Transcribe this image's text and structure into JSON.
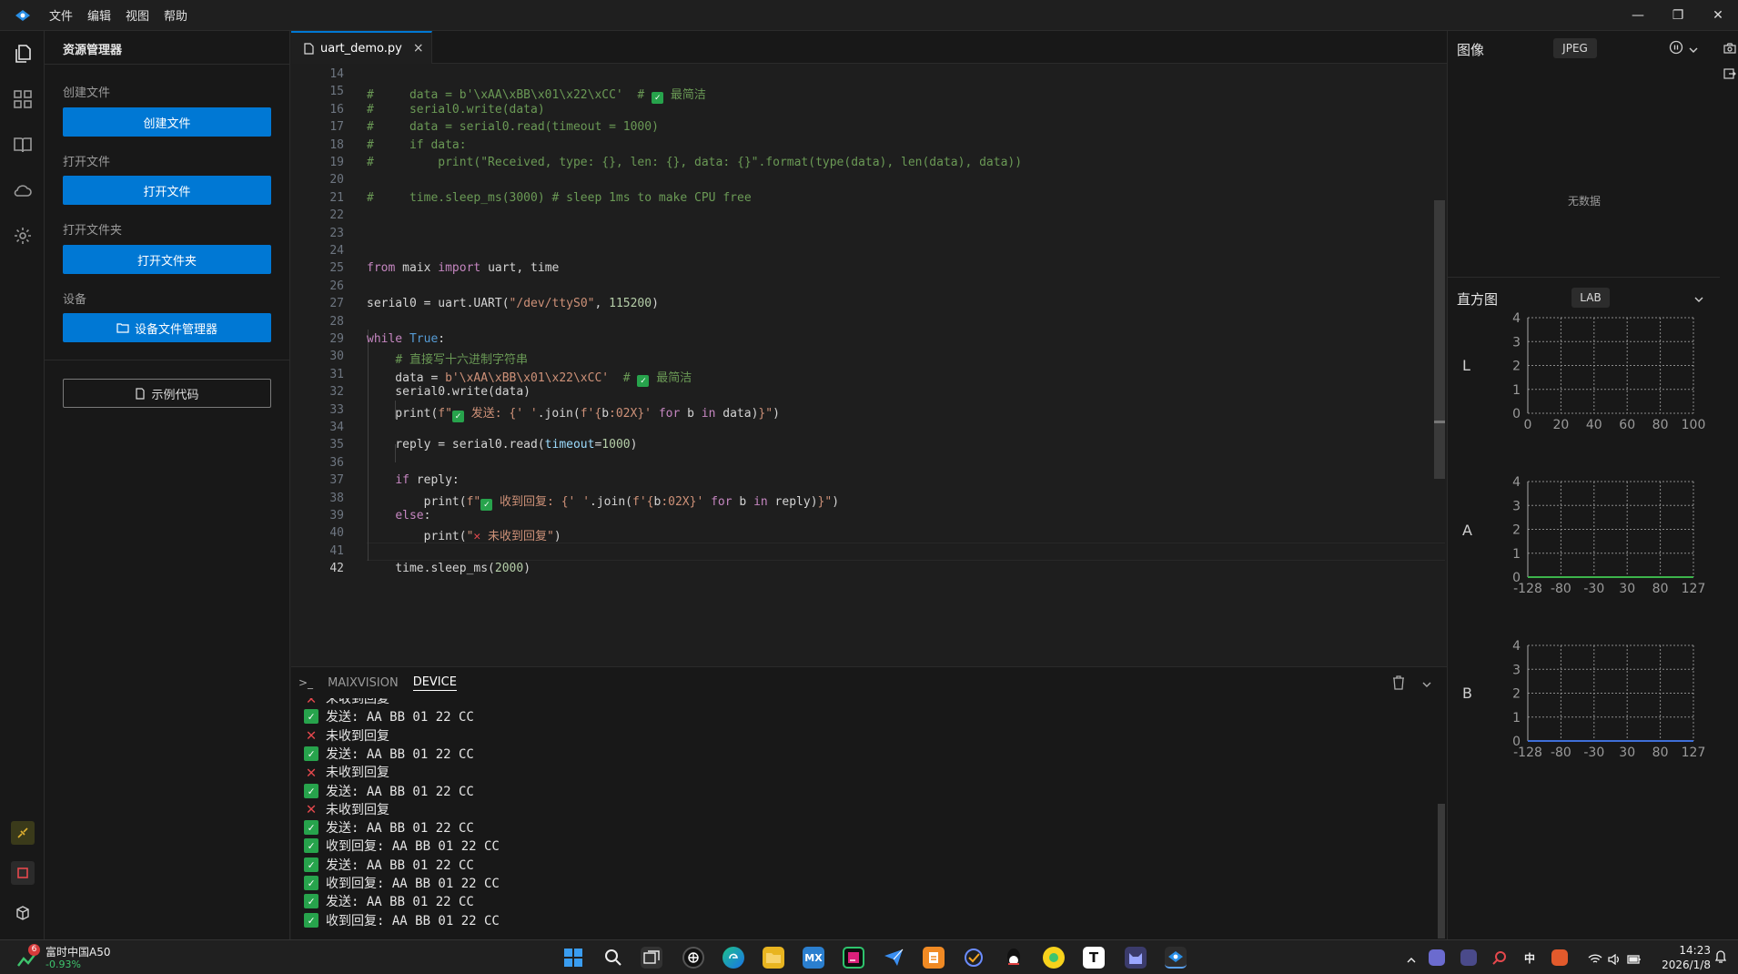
{
  "titlebar": {
    "menus": [
      "文件",
      "编辑",
      "视图",
      "帮助"
    ],
    "minimize": "—",
    "restore": "❐",
    "close": "✕"
  },
  "sidebar": {
    "title": "资源管理器",
    "create_label": "创建文件",
    "create_button": "创建文件",
    "open_label": "打开文件",
    "open_button": "打开文件",
    "open_folder_label": "打开文件夹",
    "open_folder_button": "打开文件夹",
    "device_label": "设备",
    "device_button": "设备文件管理器",
    "example_button": "示例代码"
  },
  "editor": {
    "tab": "uart_demo.py",
    "tab_close": "×",
    "active_line": 42
  },
  "code_lines": [
    {
      "n": "14",
      "html": ""
    },
    {
      "n": "15",
      "html": "<span class='cm'>#     data = b'\\xAA\\xBB\\x01\\x22\\xCC'  # </span><span class='chk'>✓</span><span class='cm'> 最简洁</span>"
    },
    {
      "n": "16",
      "html": "<span class='cm'>#     serial0.write(data)</span>"
    },
    {
      "n": "17",
      "html": "<span class='cm'>#     data = serial0.read(timeout = 1000)</span>"
    },
    {
      "n": "18",
      "html": "<span class='cm'>#     if data:</span>"
    },
    {
      "n": "19",
      "html": "<span class='cm'>#         print(\"Received, type: {}, len: {}, data: {}\".format(type(data), len(data), data))</span>"
    },
    {
      "n": "20",
      "html": ""
    },
    {
      "n": "21",
      "html": "<span class='cm'>#     time.sleep_ms(3000) # sleep 1ms to make CPU free</span>"
    },
    {
      "n": "22",
      "html": ""
    },
    {
      "n": "23",
      "html": ""
    },
    {
      "n": "24",
      "html": ""
    },
    {
      "n": "25",
      "html": "<span class='kw'>from</span> maix <span class='kw'>import</span> uart, time"
    },
    {
      "n": "26",
      "html": ""
    },
    {
      "n": "27",
      "html": "serial0 = uart.UART(<span class='st'>\"/dev/ttyS0\"</span>, <span class='nm'>115200</span>)"
    },
    {
      "n": "28",
      "html": ""
    },
    {
      "n": "29",
      "html": "<span class='kw'>while</span> <span class='kc'>True</span>:"
    },
    {
      "n": "30",
      "html": "    <span class='cm'># 直接写十六进制字符串</span>"
    },
    {
      "n": "31",
      "html": "    data = <span class='st'>b'\\xAA\\xBB\\x01\\x22\\xCC'</span>  <span class='cm'># </span><span class='chk'>✓</span><span class='cm'> 最简洁</span>"
    },
    {
      "n": "32",
      "html": "    serial0.write(data)"
    },
    {
      "n": "33",
      "html": "    print(<span class='st'>f\"</span><span class='chk'>✓</span><span class='st'> 发送: {</span><span class='st'>' '</span>.join(<span class='st'>f'{</span>b<span class='st'>:02X}'</span> <span class='kw'>for</span> b <span class='kw'>in</span> data)<span class='st'>}\"</span>)"
    },
    {
      "n": "34",
      "html": ""
    },
    {
      "n": "35",
      "html": "    reply = serial0.read(<span class='vr'>timeout</span>=<span class='nm'>1000</span>)"
    },
    {
      "n": "36",
      "html": ""
    },
    {
      "n": "37",
      "html": "    <span class='kw'>if</span> reply:"
    },
    {
      "n": "38",
      "html": "        print(<span class='st'>f\"</span><span class='chk'>✓</span><span class='st'> 收到回复: {</span><span class='st'>' '</span>.join(<span class='st'>f'{</span>b<span class='st'>:02X}'</span> <span class='kw'>for</span> b <span class='kw'>in</span> reply)<span class='st'>}\"</span>)"
    },
    {
      "n": "39",
      "html": "    <span class='kw'>else</span>:"
    },
    {
      "n": "40",
      "html": "        print(<span class='st'>\"</span><span class='xmk'>✕</span><span class='st'> 未收到回复\"</span>)"
    },
    {
      "n": "41",
      "html": ""
    },
    {
      "n": "42",
      "html": "    time.sleep_ms(<span class='nm'>2000</span>)"
    }
  ],
  "panel": {
    "prompt": ">_",
    "tabs": [
      "MAIXVISION",
      "DEVICE"
    ],
    "active_tab": "DEVICE",
    "lines": [
      {
        "ok": false,
        "text": "未收到回复"
      },
      {
        "ok": true,
        "text": "发送: AA BB 01 22 CC"
      },
      {
        "ok": false,
        "text": "未收到回复"
      },
      {
        "ok": true,
        "text": "发送: AA BB 01 22 CC"
      },
      {
        "ok": false,
        "text": "未收到回复"
      },
      {
        "ok": true,
        "text": "发送: AA BB 01 22 CC"
      },
      {
        "ok": false,
        "text": "未收到回复"
      },
      {
        "ok": true,
        "text": "发送: AA BB 01 22 CC"
      },
      {
        "ok": true,
        "text": "收到回复: AA BB 01 22 CC"
      },
      {
        "ok": true,
        "text": "发送: AA BB 01 22 CC"
      },
      {
        "ok": true,
        "text": "收到回复: AA BB 01 22 CC"
      },
      {
        "ok": true,
        "text": "发送: AA BB 01 22 CC"
      },
      {
        "ok": true,
        "text": "收到回复: AA BB 01 22 CC"
      }
    ]
  },
  "right": {
    "image_title": "图像",
    "image_format": "JPEG",
    "no_data": "无数据",
    "hist_title": "直方图",
    "hist_mode": "LAB"
  },
  "chart_data": [
    {
      "type": "line",
      "channel": "L",
      "xlim": [
        0,
        100
      ],
      "ylim": [
        0,
        4
      ],
      "xticks": [
        "0",
        "20",
        "40",
        "60",
        "80",
        "100"
      ],
      "yticks": [
        "0",
        "1",
        "2",
        "3",
        "4"
      ],
      "series": [
        {
          "values": []
        }
      ],
      "grid": true
    },
    {
      "type": "line",
      "channel": "A",
      "xlim": [
        -128,
        127
      ],
      "ylim": [
        0,
        4
      ],
      "xticks": [
        "-128",
        "-80",
        "-30",
        "30",
        "80",
        "127"
      ],
      "yticks": [
        "0",
        "1",
        "2",
        "3",
        "4"
      ],
      "series": [
        {
          "x": [
            -128,
            127
          ],
          "values": [
            0,
            0
          ],
          "color": "#3cb44b"
        }
      ],
      "grid": true
    },
    {
      "type": "line",
      "channel": "B",
      "xlim": [
        -128,
        127
      ],
      "ylim": [
        0,
        4
      ],
      "xticks": [
        "-128",
        "-80",
        "-30",
        "30",
        "80",
        "127"
      ],
      "yticks": [
        "0",
        "1",
        "2",
        "3",
        "4"
      ],
      "series": [
        {
          "x": [
            -128,
            127
          ],
          "values": [
            0,
            0
          ],
          "color": "#3f6fd8"
        }
      ],
      "grid": true
    }
  ],
  "taskbar": {
    "stock_name": "富时中国A50",
    "stock_change": "-0.93%",
    "stock_badge": "6",
    "time": "14:23",
    "date": "2026/1/8"
  }
}
